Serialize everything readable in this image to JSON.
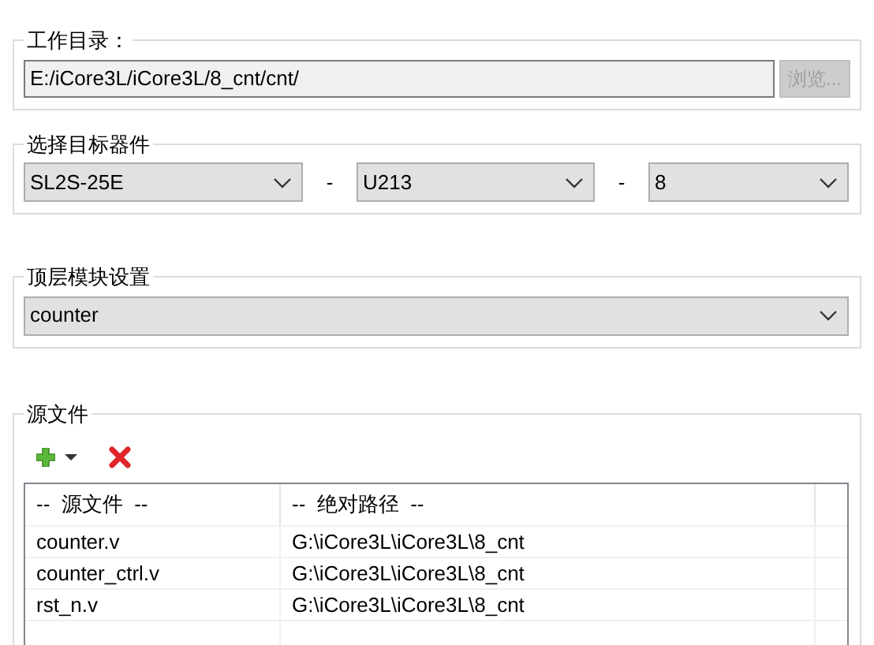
{
  "working_directory": {
    "label": "工作目录：",
    "value": "E:/iCore3L/iCore3L/8_cnt/cnt/",
    "browse_button": {
      "label": "浏览...",
      "disabled": true
    }
  },
  "target_device": {
    "label": "选择目标器件",
    "selects": [
      {
        "value": "SL2S-25E",
        "separator": "-"
      },
      {
        "value": "U213",
        "separator": "-"
      },
      {
        "value": "8"
      }
    ]
  },
  "top_module": {
    "label": "顶层模块设置",
    "value": "counter"
  },
  "source_files": {
    "label": "源文件",
    "table": {
      "columns": [
        "--  源文件  --",
        "--  绝对路径  --"
      ],
      "rows": [
        [
          "counter.v",
          "G:\\iCore3L\\iCore3L\\8_cnt"
        ],
        [
          "counter_ctrl.v",
          "G:\\iCore3L\\iCore3L\\8_cnt"
        ],
        [
          "rst_n.v",
          "G:\\iCore3L\\iCore3L\\8_cnt"
        ]
      ]
    }
  }
}
